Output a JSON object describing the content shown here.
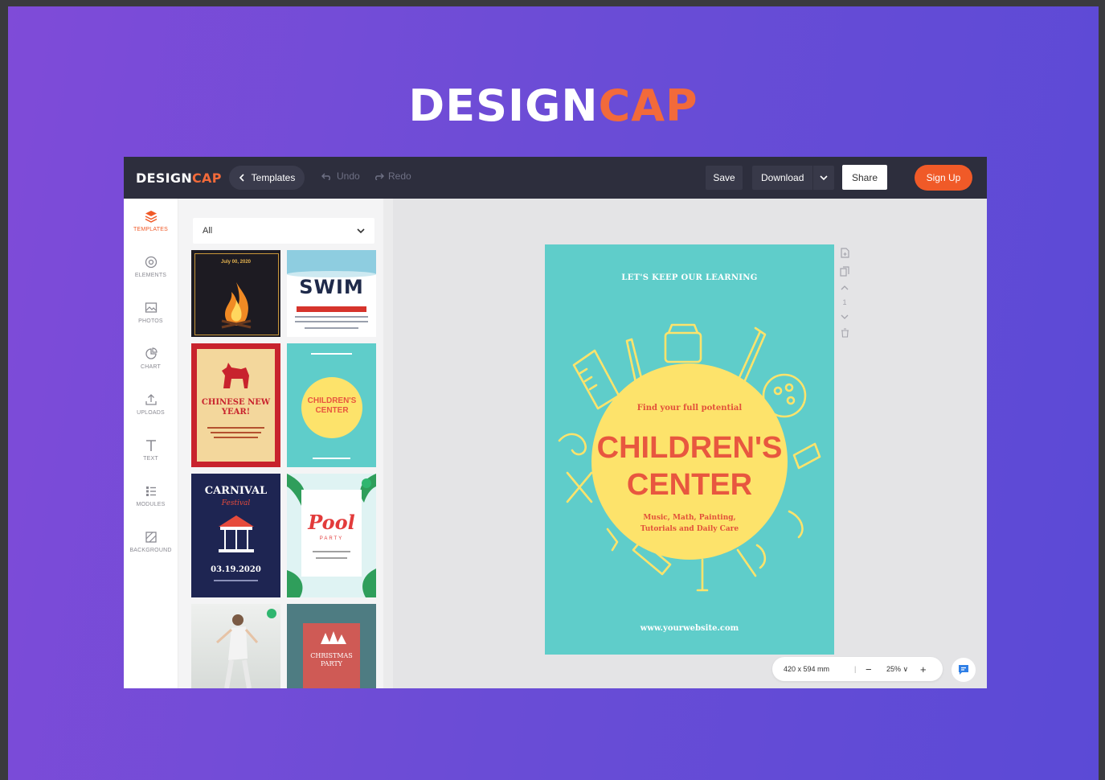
{
  "brand": {
    "design": "DESIGN",
    "cap": "CAP"
  },
  "topbar": {
    "logo_design": "DESIGN",
    "logo_cap": "CAP",
    "templates_label": "Templates",
    "undo_label": "Undo",
    "redo_label": "Redo",
    "save_label": "Save",
    "download_label": "Download",
    "share_label": "Share",
    "signup_label": "Sign Up"
  },
  "sidebar": {
    "items": [
      {
        "label": "TEMPLATES",
        "icon": "templates-icon"
      },
      {
        "label": "ELEMENTS",
        "icon": "elements-icon"
      },
      {
        "label": "PHOTOS",
        "icon": "photos-icon"
      },
      {
        "label": "CHART",
        "icon": "chart-icon"
      },
      {
        "label": "UPLOADS",
        "icon": "uploads-icon"
      },
      {
        "label": "TEXT",
        "icon": "text-icon"
      },
      {
        "label": "MODULES",
        "icon": "modules-icon"
      },
      {
        "label": "BACKGROUND",
        "icon": "background-icon"
      }
    ]
  },
  "panel": {
    "filter_value": "All",
    "thumbs": {
      "bonfire_date": "July 00, 2020",
      "swim_title": "SWIM",
      "cny_title": "CHINESE NEW YEAR!",
      "children_title": "CHILDREN'S CENTER",
      "carnival_title": "CARNIVAL",
      "carnival_sub": "Festival",
      "carnival_date": "03.19.2020",
      "pool_title": "Pool",
      "pool_sub": "PARTY",
      "xmas_title": "CHRISTMAS PARTY"
    }
  },
  "canvas": {
    "top_text": "LET'S KEEP OUR LEARNING",
    "find_text": "Find your full potential",
    "title_line1": "CHILDREN'S",
    "title_line2": "CENTER",
    "sub_line1": "Music, Math, Painting,",
    "sub_line2": "Tutorials and Daily Care",
    "website": "www.yourwebsite.com"
  },
  "page_tools": {
    "page_number": "1"
  },
  "zoom": {
    "dimensions": "420 x 594 mm",
    "percent": "25%"
  },
  "colors": {
    "accent": "#f05a28",
    "topbar": "#2d2e3d",
    "canvas_bg": "#5fcdca",
    "sun": "#fde36b"
  }
}
